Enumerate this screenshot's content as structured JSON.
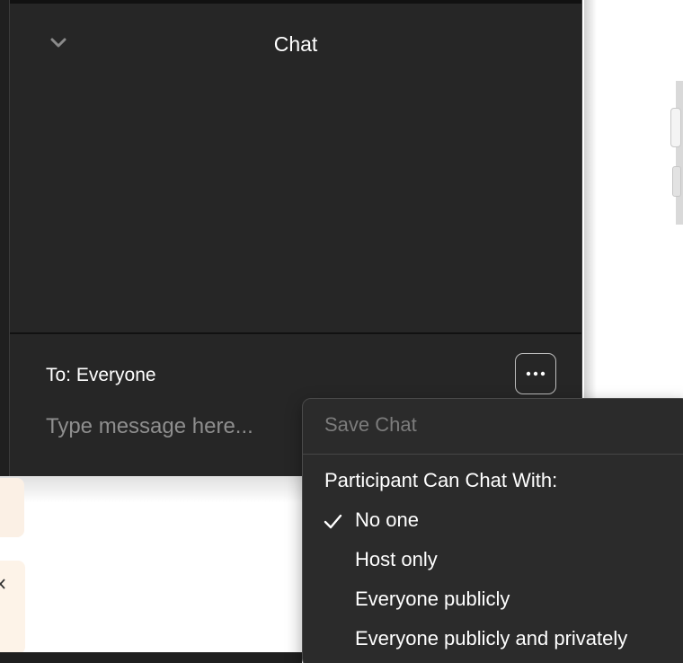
{
  "chat": {
    "title": "Chat",
    "to_label": "To: Everyone",
    "input_placeholder": "Type message here...",
    "more_icon": "ellipsis-icon",
    "collapse_icon": "chevron-down-icon"
  },
  "menu": {
    "save_chat": "Save Chat",
    "section_title": "Participant Can Chat With:",
    "options": [
      {
        "label": "No one",
        "selected": true
      },
      {
        "label": "Host only",
        "selected": false
      },
      {
        "label": "Everyone publicly",
        "selected": false
      },
      {
        "label": "Everyone publicly and privately",
        "selected": false
      }
    ],
    "check_icon": "checkmark-icon"
  },
  "colors": {
    "panel_bg": "#262626",
    "menu_bg": "#2b2b2b",
    "text_primary": "#ffffff",
    "text_disabled": "#7c7c7c",
    "placeholder": "#8e8e8e"
  }
}
